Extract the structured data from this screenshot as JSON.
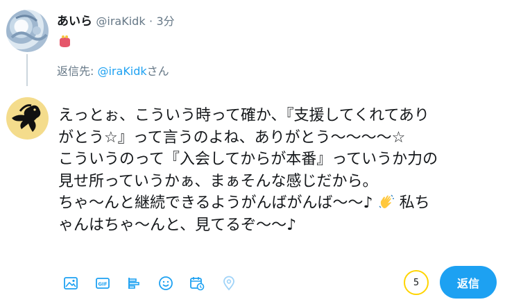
{
  "tweet": {
    "author_name": "あいら",
    "author_handle": "@iraKidk",
    "separator": "·",
    "time": "3分",
    "content_icon": "red-purse-emoji"
  },
  "reply": {
    "prefix": "返信先: ",
    "mention": "@iraKidk",
    "suffix": "さん"
  },
  "compose": {
    "text_line1": "えっとぉ、こういう時って確か、『支援してくれてあり\nがとう☆』って言うのよね、ありがとう〜〜〜〜☆\nこういうのって『入会してからが本番』っていうか力の\n見せ所っていうかぁ、まぁそんな感じだから。\nちゃ〜んと継続できるようがんばがんば〜〜♪ ",
    "text_line2": " 私ち\nゃんはちゃ〜んと、見てるぞ〜〜♪",
    "inline_icon": "waving-hand-emoji"
  },
  "toolbar": {
    "icons": [
      "image-icon",
      "gif-icon",
      "poll-icon",
      "emoji-icon",
      "schedule-icon",
      "location-icon"
    ],
    "gif_label": "GIF"
  },
  "counter": {
    "value": "5"
  },
  "buttons": {
    "reply_label": "返信"
  },
  "colors": {
    "accent": "#1da1f2",
    "counter_ring": "#ffd400",
    "muted": "#657786"
  }
}
